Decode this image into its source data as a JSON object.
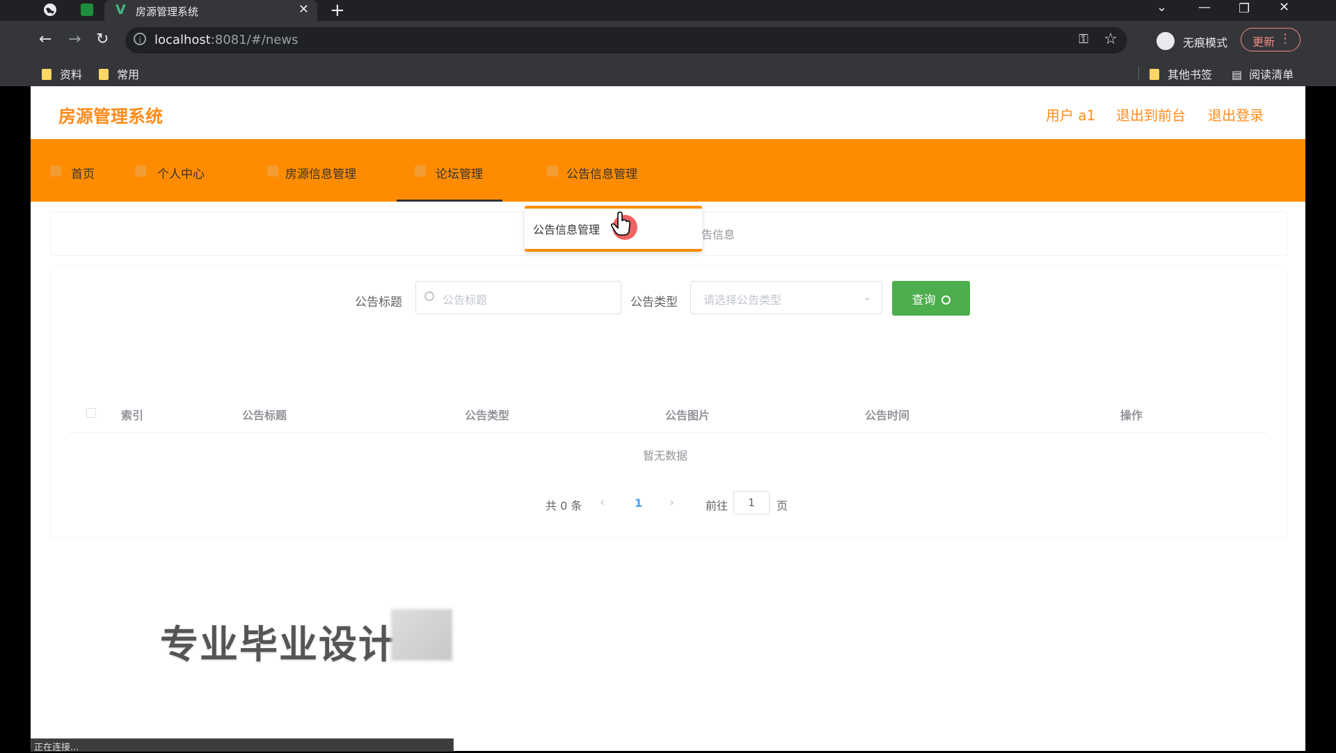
{
  "browser": {
    "tab_title": "房源管理系统",
    "url_host": "localhost",
    "url_rest": ":8081/#/news",
    "incognito_label": "无痕模式",
    "update_label": "更新",
    "bookmarks": [
      "资料",
      "常用"
    ],
    "bookmarks_right": [
      "其他书签",
      "阅读清单"
    ],
    "status_text": "正在连接..."
  },
  "app": {
    "logo": "房源管理系统",
    "user_label": "用户 a1",
    "exit_front_label": "退出到前台",
    "logout_label": "退出登录",
    "accent_color": "#ff8c00"
  },
  "menu": {
    "items": [
      "首页",
      "个人中心",
      "房源信息管理",
      "论坛管理",
      "公告信息管理"
    ],
    "active_index": 3
  },
  "dropdown": {
    "item": "公告信息管理"
  },
  "breadcrumb": {
    "partial_text": "告信息"
  },
  "search": {
    "title_label": "公告标题",
    "title_placeholder": "公告标题",
    "type_label": "公告类型",
    "type_placeholder": "请选择公告类型",
    "query_label": "查询"
  },
  "table": {
    "headers": [
      "索引",
      "公告标题",
      "公告类型",
      "公告图片",
      "公告时间",
      "操作"
    ],
    "rows": [],
    "empty_text": "暂无数据"
  },
  "pagination": {
    "total_text": "共 0 条",
    "current_page": "1",
    "goto_label": "前往",
    "goto_value": "1",
    "page_suffix": "页"
  },
  "overlay": {
    "watermark_text": "专业毕业设计"
  }
}
